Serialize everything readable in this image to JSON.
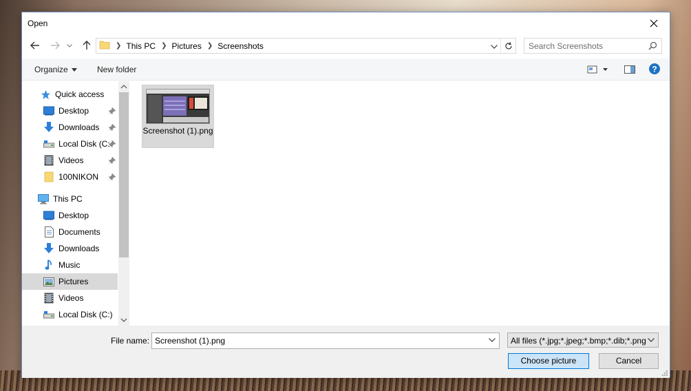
{
  "window": {
    "title": "Open"
  },
  "nav": {
    "back_icon": "arrow-left-icon",
    "forward_icon": "arrow-right-icon",
    "recent_icon": "chevron-down-icon",
    "up_icon": "arrow-up-icon"
  },
  "address": {
    "breadcrumbs": [
      "This PC",
      "Pictures",
      "Screenshots"
    ]
  },
  "search": {
    "placeholder": "Search Screenshots"
  },
  "toolbar": {
    "organize_label": "Organize",
    "new_folder_label": "New folder"
  },
  "sidebar": {
    "quick_access": {
      "label": "Quick access",
      "items": [
        {
          "label": "Desktop",
          "icon": "desktop-icon",
          "pinned": true
        },
        {
          "label": "Downloads",
          "icon": "download-icon",
          "pinned": true
        },
        {
          "label": "Local Disk (C:",
          "icon": "drive-icon",
          "pinned": true
        },
        {
          "label": "Videos",
          "icon": "video-icon",
          "pinned": true
        },
        {
          "label": "100NIKON",
          "icon": "folder-icon",
          "pinned": true
        }
      ]
    },
    "this_pc": {
      "label": "This PC",
      "items": [
        {
          "label": "Desktop",
          "icon": "desktop-icon"
        },
        {
          "label": "Documents",
          "icon": "document-icon"
        },
        {
          "label": "Downloads",
          "icon": "download-icon"
        },
        {
          "label": "Music",
          "icon": "music-icon"
        },
        {
          "label": "Pictures",
          "icon": "pictures-icon",
          "selected": true
        },
        {
          "label": "Videos",
          "icon": "video-icon"
        },
        {
          "label": "Local Disk (C:)",
          "icon": "drive-icon"
        }
      ]
    }
  },
  "files": [
    {
      "name": "Screenshot (1).png",
      "selected": true
    }
  ],
  "footer": {
    "file_name_label": "File name:",
    "file_name_value": "Screenshot (1).png",
    "file_type_filter": "All files (*.jpg;*.jpeg;*.bmp;*.dib;*.png",
    "confirm_label": "Choose picture",
    "cancel_label": "Cancel"
  },
  "colors": {
    "accent": "#0078d7",
    "selection": "#d9d9d9",
    "help": "#1e72c4"
  }
}
